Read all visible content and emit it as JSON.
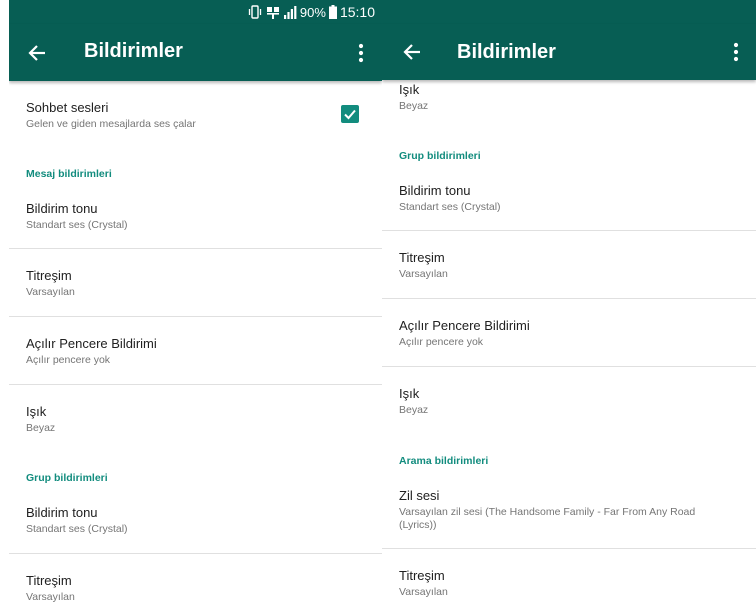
{
  "statusbar": {
    "battery_percent": "90%",
    "time": "15:10",
    "icons": [
      "vibrate-icon",
      "dual-sim-icon",
      "signal-icon",
      "battery-icon"
    ]
  },
  "appbar": {
    "title": "Bildirimler",
    "back_icon": "arrow-left-icon",
    "menu_icon": "more-vert-icon",
    "color": "#075e54"
  },
  "accent_color": "#128c7e",
  "left": {
    "chat_sounds": {
      "title": "Sohbet sesleri",
      "summary": "Gelen ve giden mesajlarda ses çalar",
      "checked": true
    },
    "message_category": "Mesaj bildirimleri",
    "message_items": [
      {
        "title": "Bildirim tonu",
        "summary": "Standart ses (Crystal)"
      },
      {
        "title": "Titreşim",
        "summary": "Varsayılan"
      },
      {
        "title": "Açılır Pencere Bildirimi",
        "summary": "Açılır pencere yok"
      },
      {
        "title": "Işık",
        "summary": "Beyaz"
      }
    ],
    "group_category": "Grup bildirimleri",
    "group_items": [
      {
        "title": "Bildirim tonu",
        "summary": "Standart ses (Crystal)"
      },
      {
        "title": "Titreşim",
        "summary": "Varsayılan"
      }
    ]
  },
  "right": {
    "top_item": {
      "title": "Işık",
      "summary": "Beyaz"
    },
    "group_category": "Grup bildirimleri",
    "group_items": [
      {
        "title": "Bildirim tonu",
        "summary": "Standart ses (Crystal)"
      },
      {
        "title": "Titreşim",
        "summary": "Varsayılan"
      },
      {
        "title": "Açılır Pencere Bildirimi",
        "summary": "Açılır pencere yok"
      },
      {
        "title": "Işık",
        "summary": "Beyaz"
      }
    ],
    "call_category": "Arama bildirimleri",
    "call_items": [
      {
        "title": "Zil sesi",
        "summary": "Varsayılan zil sesi  (The Handsome Family - Far From Any Road (Lyrics))"
      },
      {
        "title": "Titreşim",
        "summary": "Varsayılan"
      }
    ]
  }
}
